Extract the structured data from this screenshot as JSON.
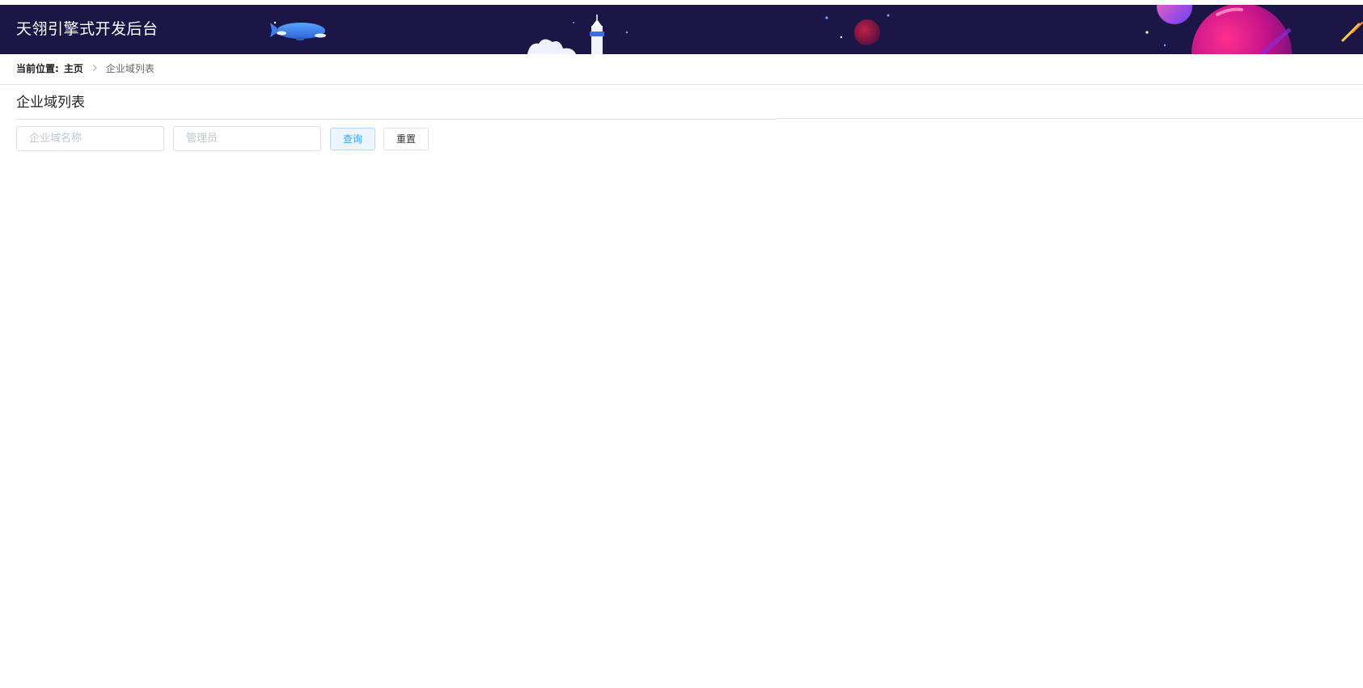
{
  "header": {
    "title": "天翎引擎式开发后台"
  },
  "breadcrumb": {
    "prefix": "当前位置:",
    "home": "主页",
    "current": "企业域列表"
  },
  "page": {
    "title": "企业域列表"
  },
  "filters": {
    "name_placeholder": "企业域名称",
    "admin_placeholder": "管理员",
    "query_label": "查询",
    "reset_label": "重置"
  },
  "icons": {
    "separator": "chevron-right-icon",
    "banner": "space-illustration"
  },
  "colors": {
    "header_bg": "#1b1646",
    "primary": "#409eff",
    "primary_light": "#ecf5ff"
  }
}
